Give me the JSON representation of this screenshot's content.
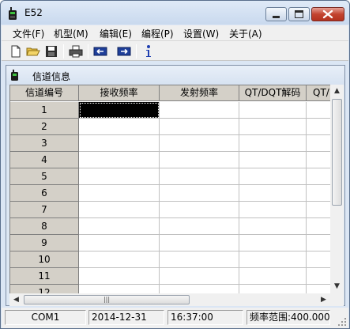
{
  "window": {
    "title": "E52"
  },
  "menu": [
    "文件(F)",
    "机型(M)",
    "编辑(E)",
    "编程(P)",
    "设置(W)",
    "关于(A)"
  ],
  "toolbar": [
    "new-file-icon",
    "open-folder-icon",
    "save-icon",
    "print-icon",
    "read-from-radio-icon",
    "write-to-radio-icon",
    "info-icon"
  ],
  "channel_window": {
    "title": "信道信息",
    "columns": [
      "信道编号",
      "接收频率",
      "发射频率",
      "QT/DQT解码",
      "QT/"
    ],
    "rows": [
      "1",
      "2",
      "3",
      "4",
      "5",
      "6",
      "7",
      "8",
      "9",
      "10",
      "11",
      "12"
    ],
    "selected_cell": {
      "row": 1,
      "column": "接收频率"
    }
  },
  "status": {
    "port": "COM1",
    "date": "2014-12-31",
    "time": "16:37:00",
    "freq_range": "频率范围:400.0000"
  }
}
